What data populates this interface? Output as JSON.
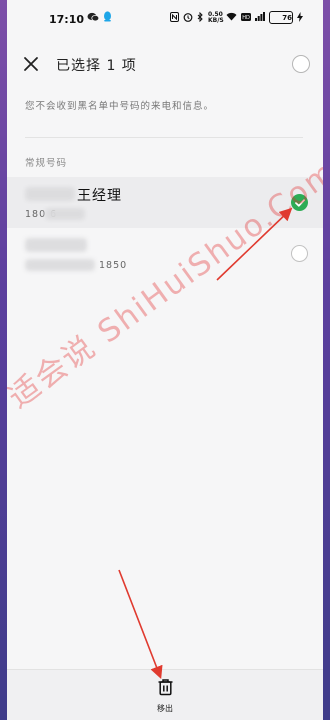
{
  "status_bar": {
    "time": "17:10",
    "network_speed": "0.50 KB/S",
    "battery": "76",
    "icons": [
      "wechat-icon",
      "qq-icon",
      "nfc-icon",
      "alarm-icon",
      "bluetooth-icon",
      "speed-icon",
      "wifi-icon",
      "hd-icon",
      "signal-icon",
      "battery-icon",
      "charging-icon"
    ]
  },
  "header": {
    "title": "已选择 1 项"
  },
  "hint": "您不会收到黑名单中号码的来电和信息。",
  "section_title": "常规号码",
  "contacts": [
    {
      "name": "王经理",
      "number": "180 6",
      "selected": true
    },
    {
      "name": "",
      "number": "1850",
      "selected": false
    }
  ],
  "bottom": {
    "delete_label": "移出"
  },
  "watermark": "适会说 ShiHuiShuo.Com",
  "colors": {
    "accent_check": "#2dac55",
    "annotation_red": "#e03a2f"
  }
}
